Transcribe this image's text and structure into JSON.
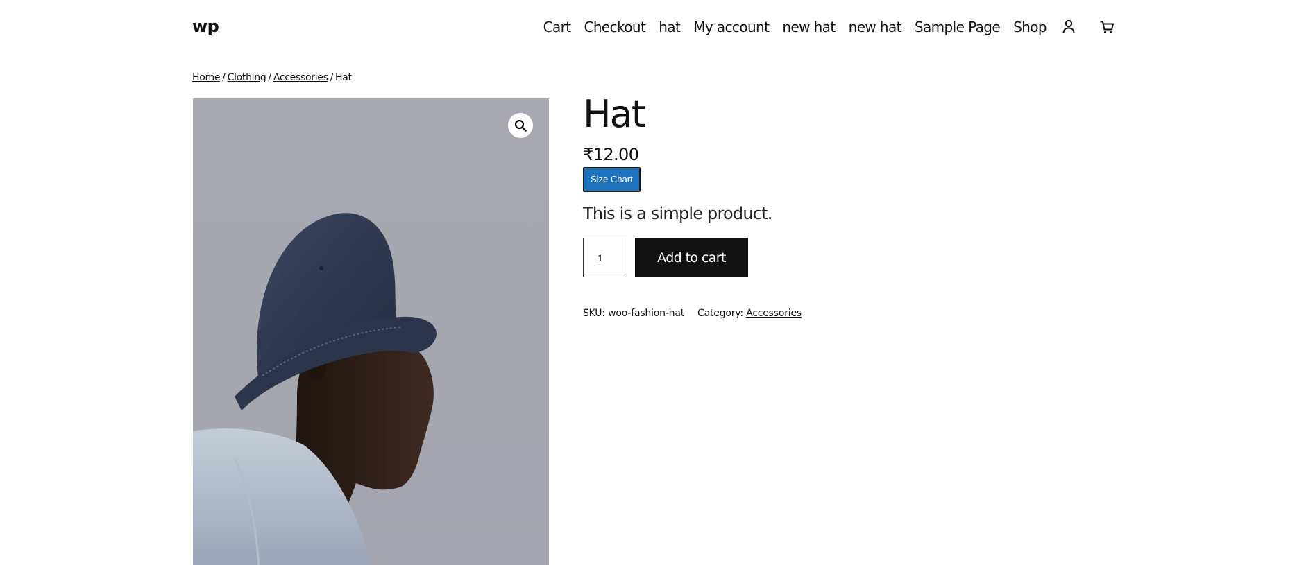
{
  "site": {
    "title": "wp"
  },
  "nav": {
    "items": [
      "Cart",
      "Checkout",
      "hat",
      "My account",
      "new hat",
      "new hat",
      "Sample Page",
      "Shop"
    ],
    "account_icon": "user-icon",
    "cart_icon": "cart-icon"
  },
  "breadcrumb": {
    "items": [
      "Home",
      "Clothing",
      "Accessories"
    ],
    "current": "Hat",
    "separator": "/"
  },
  "product": {
    "title": "Hat",
    "price": "₹12.00",
    "size_chart_label": "Size Chart",
    "short_description": "This is a simple product.",
    "quantity": "1",
    "add_to_cart_label": "Add to cart",
    "sku_label": "SKU:",
    "sku": "woo-fashion-hat",
    "category_label": "Category:",
    "category": "Accessories",
    "zoom_icon": "magnifier-icon"
  },
  "colors": {
    "size_chart_bg": "#1e73be",
    "button_bg": "#111111",
    "photo_bg": "#a8a8b0"
  }
}
